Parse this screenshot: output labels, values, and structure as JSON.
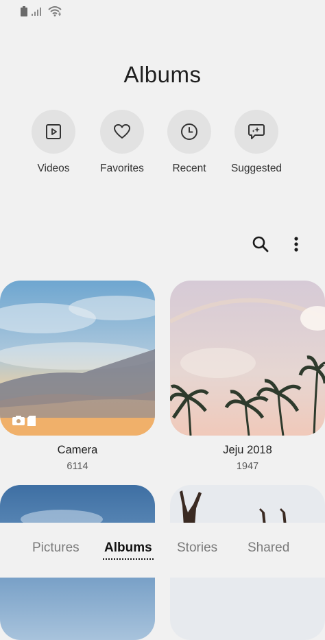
{
  "status_bar": {
    "icons": [
      "battery-icon",
      "signal-icon",
      "wifi-icon"
    ]
  },
  "header": {
    "title": "Albums"
  },
  "quick_access": [
    {
      "label": "Videos",
      "icon": "video-icon"
    },
    {
      "label": "Favorites",
      "icon": "heart-icon"
    },
    {
      "label": "Recent",
      "icon": "clock-icon"
    },
    {
      "label": "Suggested",
      "icon": "sparkle-chat-icon"
    }
  ],
  "toolbar": {
    "icons": [
      "search-icon",
      "more-options-icon"
    ]
  },
  "albums": [
    {
      "name": "Camera",
      "count": "6114"
    },
    {
      "name": "Jeju 2018",
      "count": "1947"
    }
  ],
  "bottom_nav": {
    "tabs": [
      "Pictures",
      "Albums",
      "Stories",
      "Shared"
    ],
    "active": "Albums"
  },
  "colors": {
    "background": "#f1f1f1",
    "circle": "#e2e2e2",
    "active_tab": "#111111",
    "inactive_tab": "#7a7a7a"
  }
}
